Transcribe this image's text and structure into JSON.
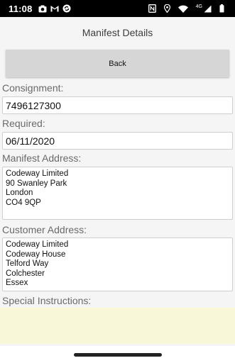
{
  "status_bar": {
    "time": "11:08",
    "network_label": "4G",
    "icons": [
      "camera-icon",
      "gmail-icon",
      "sync-icon",
      "nfc-icon",
      "location-icon",
      "wifi-icon",
      "signal-icon",
      "battery-icon"
    ]
  },
  "page": {
    "title": "Manifest Details",
    "back_label": "Back"
  },
  "form": {
    "consignment_label": "Consignment:",
    "consignment_value": "7496127300",
    "required_label": "Required:",
    "required_value": "06/11/2020",
    "manifest_address_label": "Manifest Address:",
    "manifest_address_lines": [
      "Codeway Limited",
      "90 Swanley Park",
      "London",
      "CO4 9QP"
    ],
    "customer_address_label": "Customer Address:",
    "customer_address_lines": [
      "Codeway Limited",
      "Codeway House",
      "Telford Way",
      "Colchester",
      "Essex"
    ],
    "special_instructions_label": "Special Instructions:",
    "special_instructions_value": ""
  },
  "colors": {
    "special_instructions_bg": "#f8f8d8",
    "back_button_bg": "#d6d6d6",
    "status_bar_bg": "#000000"
  }
}
